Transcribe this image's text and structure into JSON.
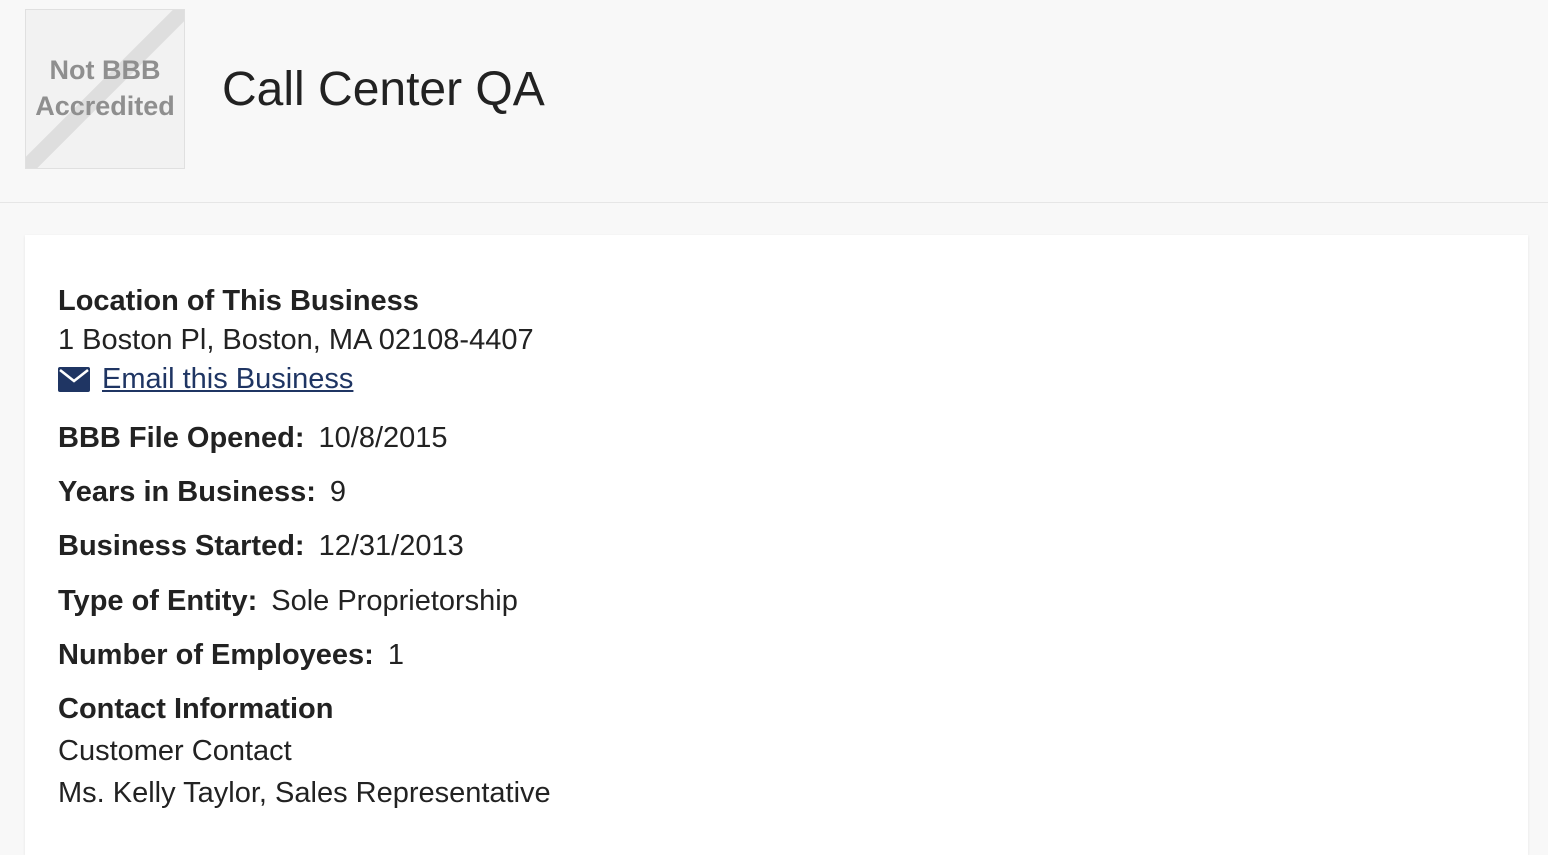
{
  "header": {
    "badge": {
      "line1": "Not BBB",
      "line2": "Accredited"
    },
    "business_name": "Call Center QA"
  },
  "location": {
    "label": "Location of This Business",
    "address": "1 Boston Pl, Boston, MA 02108-4407",
    "email_link": "Email this Business",
    "email_icon": "envelope-icon"
  },
  "details": {
    "file_opened": {
      "label": "BBB File Opened:",
      "value": "10/8/2015"
    },
    "years_in_business": {
      "label": "Years in Business:",
      "value": "9"
    },
    "business_started": {
      "label": "Business Started:",
      "value": "12/31/2013"
    },
    "entity_type": {
      "label": "Type of Entity:",
      "value": "Sole Proprietorship"
    },
    "employees": {
      "label": "Number of Employees:",
      "value": "1"
    }
  },
  "contact": {
    "label": "Contact Information",
    "role": "Customer Contact",
    "person": "Ms. Kelly Taylor, Sales Representative"
  },
  "colors": {
    "link": "#1f3563",
    "icon": "#1f3563",
    "text": "#222222",
    "badge_text": "#8f8f8f"
  }
}
